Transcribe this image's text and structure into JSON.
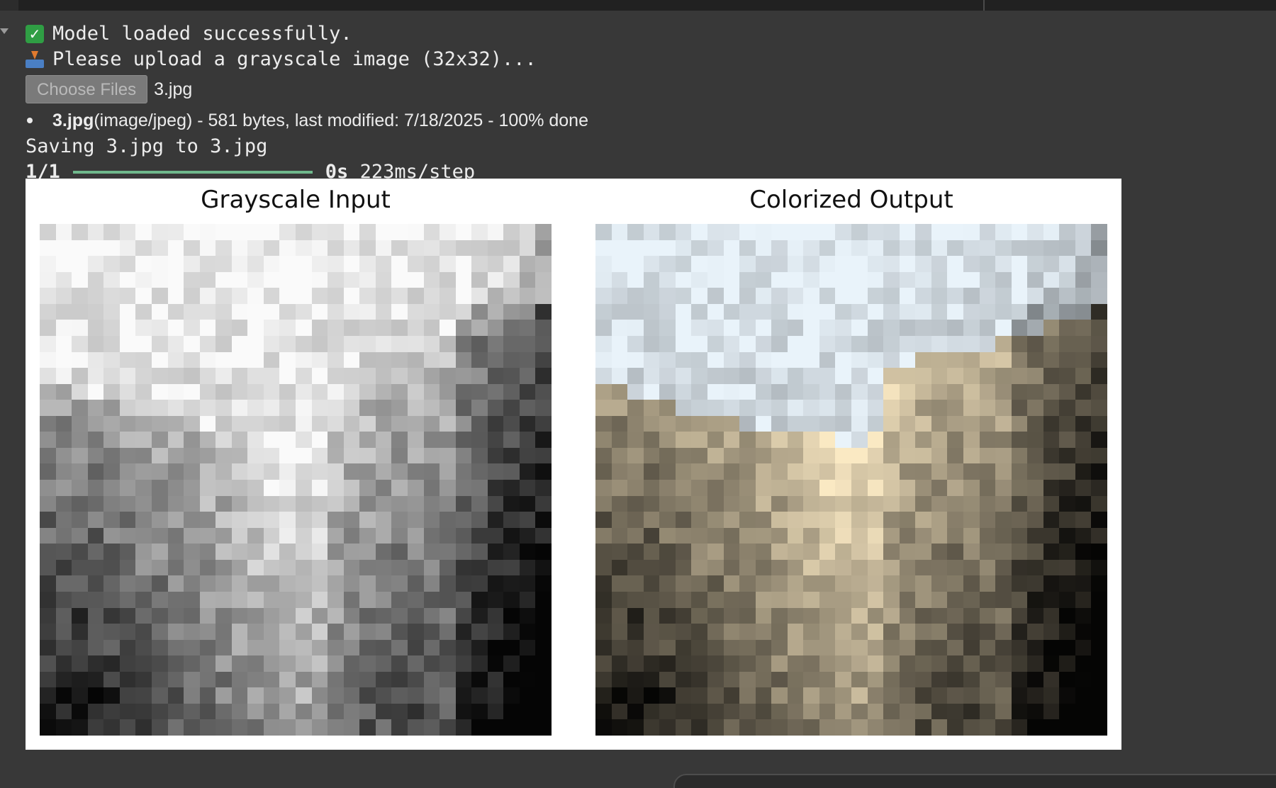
{
  "output": {
    "model_status": "Model loaded successfully.",
    "upload_prompt": "Please upload a grayscale image (32x32)...",
    "choose_files_label": "Choose Files",
    "selected_file": "3.jpg",
    "file_info": {
      "name": "3.jpg",
      "details": "(image/jpeg) - 581 bytes, last modified: 7/18/2025 - 100% done"
    },
    "saving_message": "Saving 3.jpg to 3.jpg",
    "progress": {
      "step": "1/1",
      "fraction": 1.0,
      "time": "0s",
      "rate": "223ms/step"
    }
  },
  "figure": {
    "left_title": "Grayscale Input",
    "right_title": "Colorized Output",
    "grid_size": 32
  },
  "colors": {
    "progress_fill": "#6fb88c",
    "check": "#2f9e44",
    "background": "#383838"
  }
}
